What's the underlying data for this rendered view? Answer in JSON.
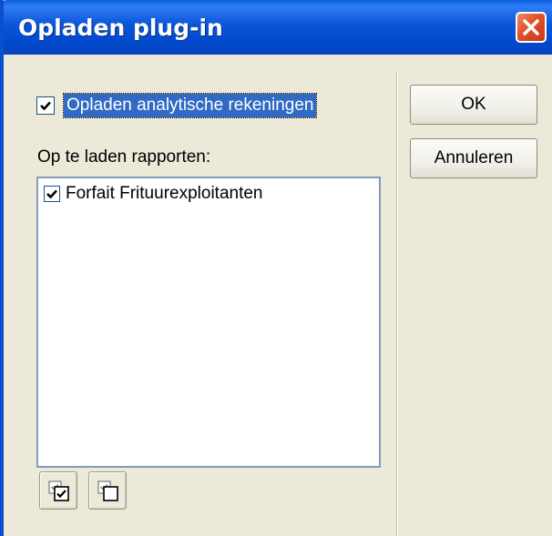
{
  "window": {
    "title": "Opladen plug-in"
  },
  "options": {
    "load_analytic_accounts": {
      "label": "Opladen analytische rekeningen",
      "checked": true
    }
  },
  "reports": {
    "label": "Op te laden rapporten:",
    "items": [
      {
        "label": "Forfait Frituurexploitanten",
        "checked": true
      }
    ]
  },
  "buttons": {
    "ok": "OK",
    "cancel": "Annuleren"
  },
  "icons": {
    "close": "close-icon",
    "check_all": "check-all-icon",
    "uncheck_all": "uncheck-all-icon"
  },
  "colors": {
    "title_bar": "#0b55d8",
    "close_button": "#e2542c",
    "selection": "#316ac5",
    "dialog_background": "#ece9d8"
  }
}
